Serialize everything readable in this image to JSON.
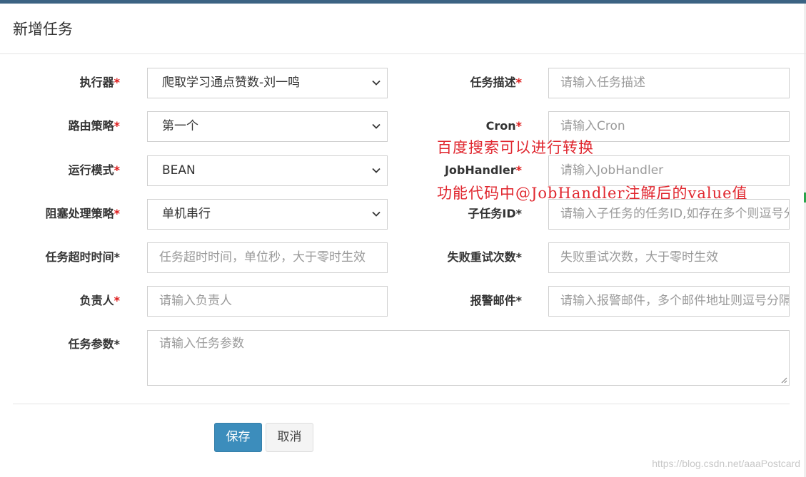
{
  "dialog": {
    "title": "新增任务"
  },
  "form": {
    "executor": {
      "label": "执行器",
      "required_mark": "*",
      "value": "爬取学习通点赞数-刘一鸣"
    },
    "description": {
      "label": "任务描述",
      "required_mark": "*",
      "placeholder": "请输入任务描述"
    },
    "route_strategy": {
      "label": "路由策略",
      "required_mark": "*",
      "value": "第一个"
    },
    "cron": {
      "label": "Cron",
      "required_mark": "*",
      "placeholder": "请输入Cron"
    },
    "run_mode": {
      "label": "运行模式",
      "required_mark": "*",
      "value": "BEAN"
    },
    "job_handler": {
      "label": "JobHandler",
      "required_mark": "*",
      "placeholder": "请输入JobHandler"
    },
    "block_strategy": {
      "label": "阻塞处理策略",
      "required_mark": "*",
      "value": "单机串行"
    },
    "child_job_id": {
      "label": "子任务ID*",
      "placeholder": "请输入子任务的任务ID,如存在多个则逗号分隔"
    },
    "timeout": {
      "label": "任务超时时间*",
      "placeholder": "任务超时时间，单位秒，大于零时生效"
    },
    "fail_retry": {
      "label": "失败重试次数*",
      "placeholder": "失败重试次数，大于零时生效"
    },
    "author": {
      "label": "负责人",
      "required_mark": "*",
      "placeholder": "请输入负责人"
    },
    "alarm_email": {
      "label": "报警邮件*",
      "placeholder": "请输入报警邮件，多个邮件地址则逗号分隔"
    },
    "params": {
      "label": "任务参数*",
      "placeholder": "请输入任务参数"
    }
  },
  "annotations": {
    "note1": "百度搜索可以进行转换",
    "note2": "功能代码中@JobHandler注解后的value值"
  },
  "buttons": {
    "save": "保存",
    "cancel": "取消"
  },
  "watermark": "https://blog.csdn.net/aaaPostcard",
  "colors": {
    "required": "#dd1a1a",
    "primary": "#3c8dbc",
    "annotation": "#e0262e",
    "topbar": "#3c6383"
  },
  "icons": {
    "select_arrow": "chevron-down-icon",
    "resize": "resize-grip-icon"
  }
}
